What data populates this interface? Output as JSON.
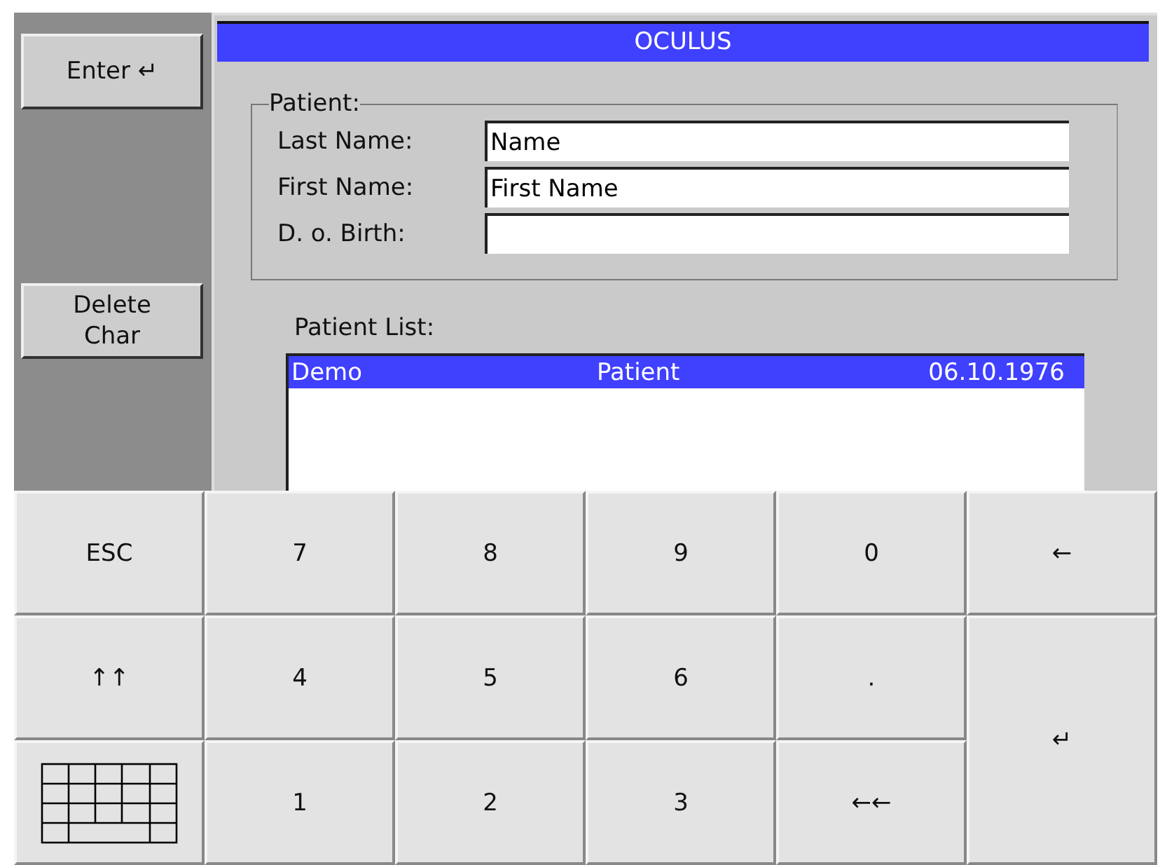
{
  "side_buttons": [
    "Enter ↵",
    "Delete\nChar"
  ],
  "dialog": {
    "title": "OCULUS",
    "patient_group": {
      "legend": "Patient:",
      "fields": [
        {
          "label": "Last Name:",
          "value": "Name"
        },
        {
          "label": "First Name:",
          "value": "First Name"
        },
        {
          "label": "D. o. Birth:"
        }
      ]
    },
    "patient_list": {
      "label": "Patient List:",
      "rows": [
        {
          "cells": [
            "Demo",
            "Patient",
            "06.10.1976"
          ],
          "selected": true
        }
      ]
    }
  },
  "keypad": [
    {
      "kind": "text",
      "label": "ESC",
      "tall": false
    },
    {
      "kind": "text",
      "label": "7",
      "tall": false
    },
    {
      "kind": "text",
      "label": "8",
      "tall": false
    },
    {
      "kind": "text",
      "label": "9",
      "tall": false
    },
    {
      "kind": "text",
      "label": "0",
      "tall": false
    },
    {
      "kind": "text",
      "label": "←",
      "tall": false
    },
    {
      "kind": "text",
      "label": "↑↑",
      "tall": false
    },
    {
      "kind": "text",
      "label": "4",
      "tall": false
    },
    {
      "kind": "text",
      "label": "5",
      "tall": false
    },
    {
      "kind": "text",
      "label": "6",
      "tall": false
    },
    {
      "kind": "text",
      "label": ".",
      "tall": false
    },
    {
      "kind": "text",
      "label": "↵",
      "tall": true
    },
    {
      "kind": "keyboard",
      "tall": false
    },
    {
      "kind": "text",
      "label": "1",
      "tall": false
    },
    {
      "kind": "text",
      "label": "2",
      "tall": false
    },
    {
      "kind": "text",
      "label": "3",
      "tall": false
    },
    {
      "kind": "text",
      "label": "←←",
      "tall": false
    }
  ]
}
